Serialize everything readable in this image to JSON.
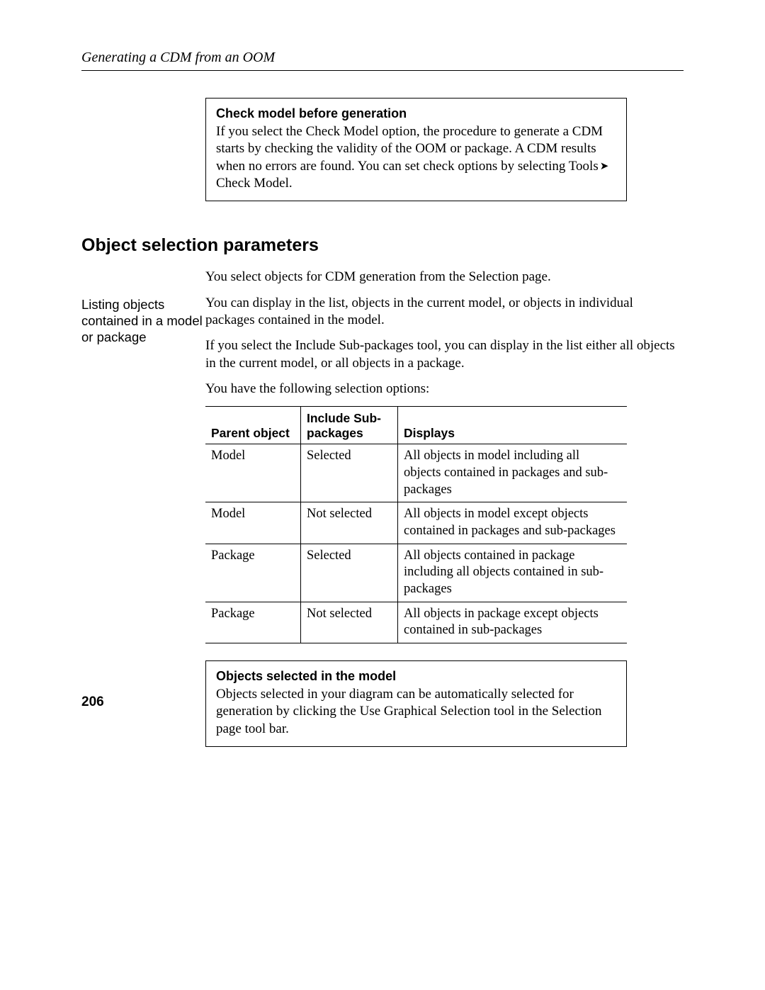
{
  "running_head": "Generating a CDM from an OOM",
  "box1": {
    "title": "Check model before generation",
    "body_part1": "If you select the Check Model option, the procedure to generate a CDM starts by checking the validity of the OOM or package. A CDM results when no errors are found. You can set check options by selecting Tools",
    "body_part2": "Check Model."
  },
  "section_heading": "Object selection parameters",
  "intro_para": "You select objects for CDM generation from the Selection page.",
  "side_label": "Listing objects contained in a model or package",
  "para2": "You can display in the list, objects in the current model, or objects in individual packages contained in the model.",
  "para3": "If you select the Include Sub-packages tool, you can display in the list either all objects in the current model, or all objects in a package.",
  "para4": "You have the following selection options:",
  "table": {
    "headers": {
      "col1": "Parent object",
      "col2": "Include Sub-packages",
      "col3": "Displays"
    },
    "rows": [
      {
        "c1": "Model",
        "c2": "Selected",
        "c3": "All objects in model including all objects contained in packages and sub-packages"
      },
      {
        "c1": "Model",
        "c2": "Not selected",
        "c3": "All objects in model except objects contained in packages and sub-packages"
      },
      {
        "c1": "Package",
        "c2": "Selected",
        "c3": "All objects contained in package including all objects contained in sub-packages"
      },
      {
        "c1": "Package",
        "c2": "Not selected",
        "c3": "All objects in package except objects contained in sub-packages"
      }
    ]
  },
  "box2": {
    "title": "Objects selected in the model",
    "body": "Objects selected in your diagram can be automatically selected for generation by clicking the Use Graphical Selection tool in the Selection page tool bar."
  },
  "page_number": "206"
}
